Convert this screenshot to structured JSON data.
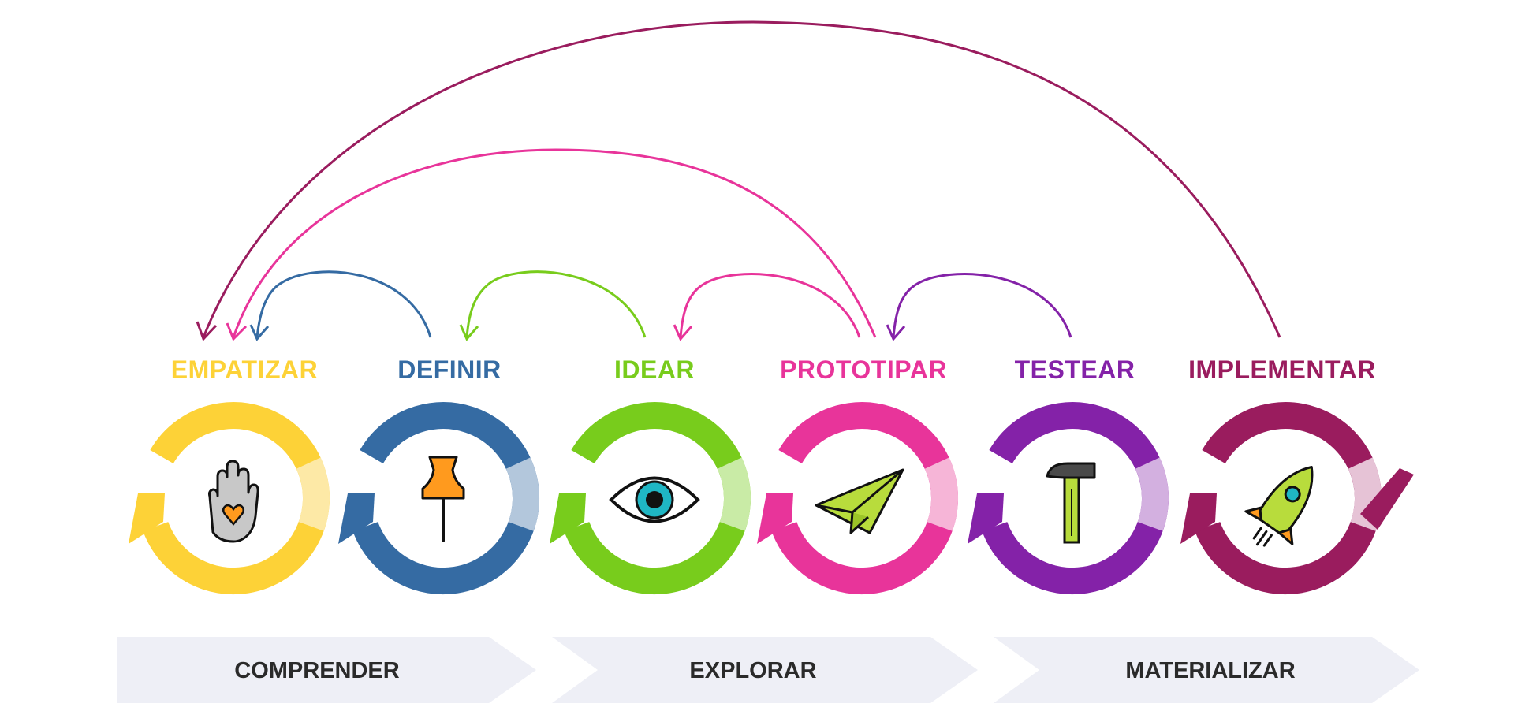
{
  "stages": [
    {
      "id": "empatizar",
      "label": "EMPATIZAR",
      "color": "#fdd237",
      "light": "#fde9a6",
      "icon": "hand-heart-icon"
    },
    {
      "id": "definir",
      "label": "DEFINIR",
      "color": "#356ba3",
      "light": "#b3c7dc",
      "icon": "pushpin-icon"
    },
    {
      "id": "idear",
      "label": "IDEAR",
      "color": "#78cc1c",
      "light": "#c9eba6",
      "icon": "eye-icon"
    },
    {
      "id": "prototipar",
      "label": "PROTOTIPAR",
      "color": "#e8349a",
      "light": "#f6b5d7",
      "icon": "paper-plane-icon"
    },
    {
      "id": "testear",
      "label": "TESTEAR",
      "color": "#8422a8",
      "light": "#d3b0e0",
      "icon": "hammer-icon"
    },
    {
      "id": "implementar",
      "label": "IMPLEMENTAR",
      "color": "#9a1c5e",
      "light": "#e6c3d6",
      "icon": "rocket-icon"
    }
  ],
  "feedback_arrows": [
    {
      "from": "definir",
      "to": "empatizar",
      "color": "#356ba3"
    },
    {
      "from": "idear",
      "to": "definir",
      "color": "#78cc1c"
    },
    {
      "from": "prototipar",
      "to": "idear",
      "color": "#e8349a"
    },
    {
      "from": "testear",
      "to": "prototipar",
      "color": "#8422a8"
    },
    {
      "from": "prototipar",
      "to": "empatizar",
      "color": "#e8349a"
    },
    {
      "from": "implementar",
      "to": "empatizar",
      "color": "#9a1c5e"
    }
  ],
  "phases": [
    {
      "label": "COMPRENDER"
    },
    {
      "label": "EXPLORAR"
    },
    {
      "label": "MATERIALIZAR"
    }
  ]
}
